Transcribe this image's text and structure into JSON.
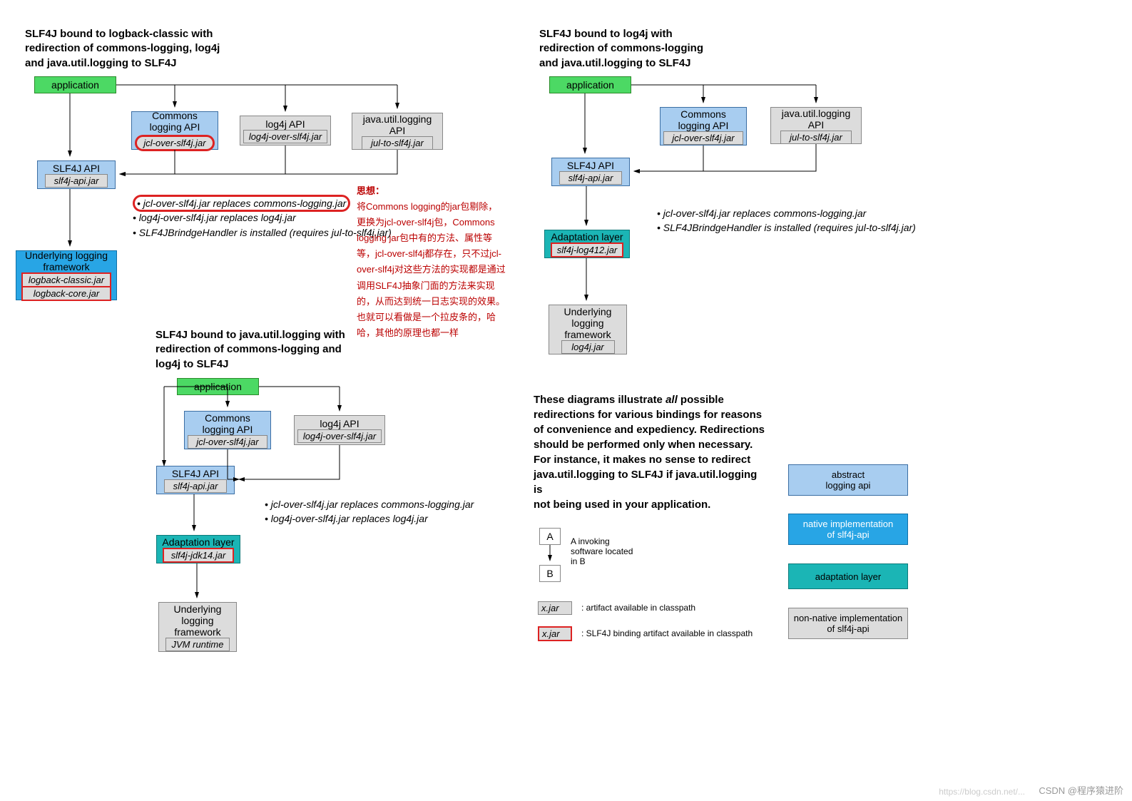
{
  "diagram1": {
    "title": "SLF4J bound to logback-classic with\nredirection of commons-logging, log4j\nand java.util.logging to SLF4J",
    "application": "application",
    "commons_api": "Commons\nlogging API",
    "jcl_jar": "jcl-over-slf4j.jar",
    "log4j_api": "log4j API",
    "log4j_jar": "log4j-over-slf4j.jar",
    "jul_api": "java.util.logging\nAPI",
    "jul_jar": "jul-to-slf4j.jar",
    "slf4j_api": "SLF4J API",
    "slf4j_jar": "slf4j-api.jar",
    "bul1": "• jcl-over-slf4j.jar replaces commons-logging.jar",
    "bul2": "• log4j-over-slf4j.jar replaces log4j.jar",
    "bul3": "• SLF4JBrindgeHandler is installed (requires jul-to-slf4j.jar)",
    "underlying": "Underlying logging\nframework",
    "logback1": "logback-classic.jar",
    "logback2": "logback-core.jar"
  },
  "redtxt": {
    "h": "思想：",
    "body": "将Commons logging的jar包剔除，更换为jcl-over-slf4j包，Commons logging jar包中有的方法、属性等等，jcl-over-slf4j都存在，只不过jcl-over-slf4j对这些方法的实现都是通过调用SLF4J抽象门面的方法来实现的，从而达到统一日志实现的效果。也就可以看做是一个拉皮条的，哈哈，其他的原理也都一样"
  },
  "diagram2": {
    "title": "SLF4J bound to java.util.logging with\nredirection of commons-logging and\nlog4j to SLF4J",
    "application": "application",
    "commons_api": "Commons\nlogging API",
    "jcl_jar": "jcl-over-slf4j.jar",
    "log4j_api": "log4j API",
    "log4j_jar": "log4j-over-slf4j.jar",
    "slf4j_api": "SLF4J API",
    "slf4j_jar": "slf4j-api.jar",
    "bul1": "• jcl-over-slf4j.jar replaces commons-logging.jar",
    "bul2": "• log4j-over-slf4j.jar replaces log4j.jar",
    "adaptation": "Adaptation layer",
    "adapt_jar": "slf4j-jdk14.jar",
    "underlying": "Underlying\nlogging\nframework",
    "ul_jar": "JVM runtime"
  },
  "diagram3": {
    "title": "SLF4J bound to log4j with\nredirection of commons-logging\nand java.util.logging to SLF4J",
    "application": "application",
    "commons_api": "Commons\nlogging API",
    "jcl_jar": "jcl-over-slf4j.jar",
    "jul_api": "java.util.logging\nAPI",
    "jul_jar": "jul-to-slf4j.jar",
    "slf4j_api": "SLF4J API",
    "slf4j_jar": "slf4j-api.jar",
    "bul1": "• jcl-over-slf4j.jar replaces commons-logging.jar",
    "bul2": "• SLF4JBrindgeHandler is installed (requires jul-to-slf4j.jar)",
    "adaptation": "Adaptation layer",
    "adapt_jar": "slf4j-log412.jar",
    "underlying": "Underlying\nlogging\nframework",
    "ul_jar": "log4j.jar"
  },
  "description": "These diagrams illustrate all possible redirections for various bindings for reasons of convenience and expediency. Redirections should be performed only when necessary. For instance, it makes no sense to redirect java.util.logging to SLF4J if java.util.logging is\nnot being used in your application.",
  "legend": {
    "A": "A",
    "B": "B",
    "AB_text": "A invoking\nsoftware located\nin B",
    "xjar1": "x.jar",
    "xjar1_text": ": artifact available in classpath",
    "xjar2": "x.jar",
    "xjar2_text": ": SLF4J binding artifact available in classpath",
    "l1": "abstract\nlogging api",
    "l2": "native implementation\nof slf4j-api",
    "l3": "adaptation layer",
    "l4": "non-native implementation\nof slf4j-api"
  },
  "watermark": "CSDN @程序猿进阶",
  "watermark2": "https://blog.csdn.net/..."
}
